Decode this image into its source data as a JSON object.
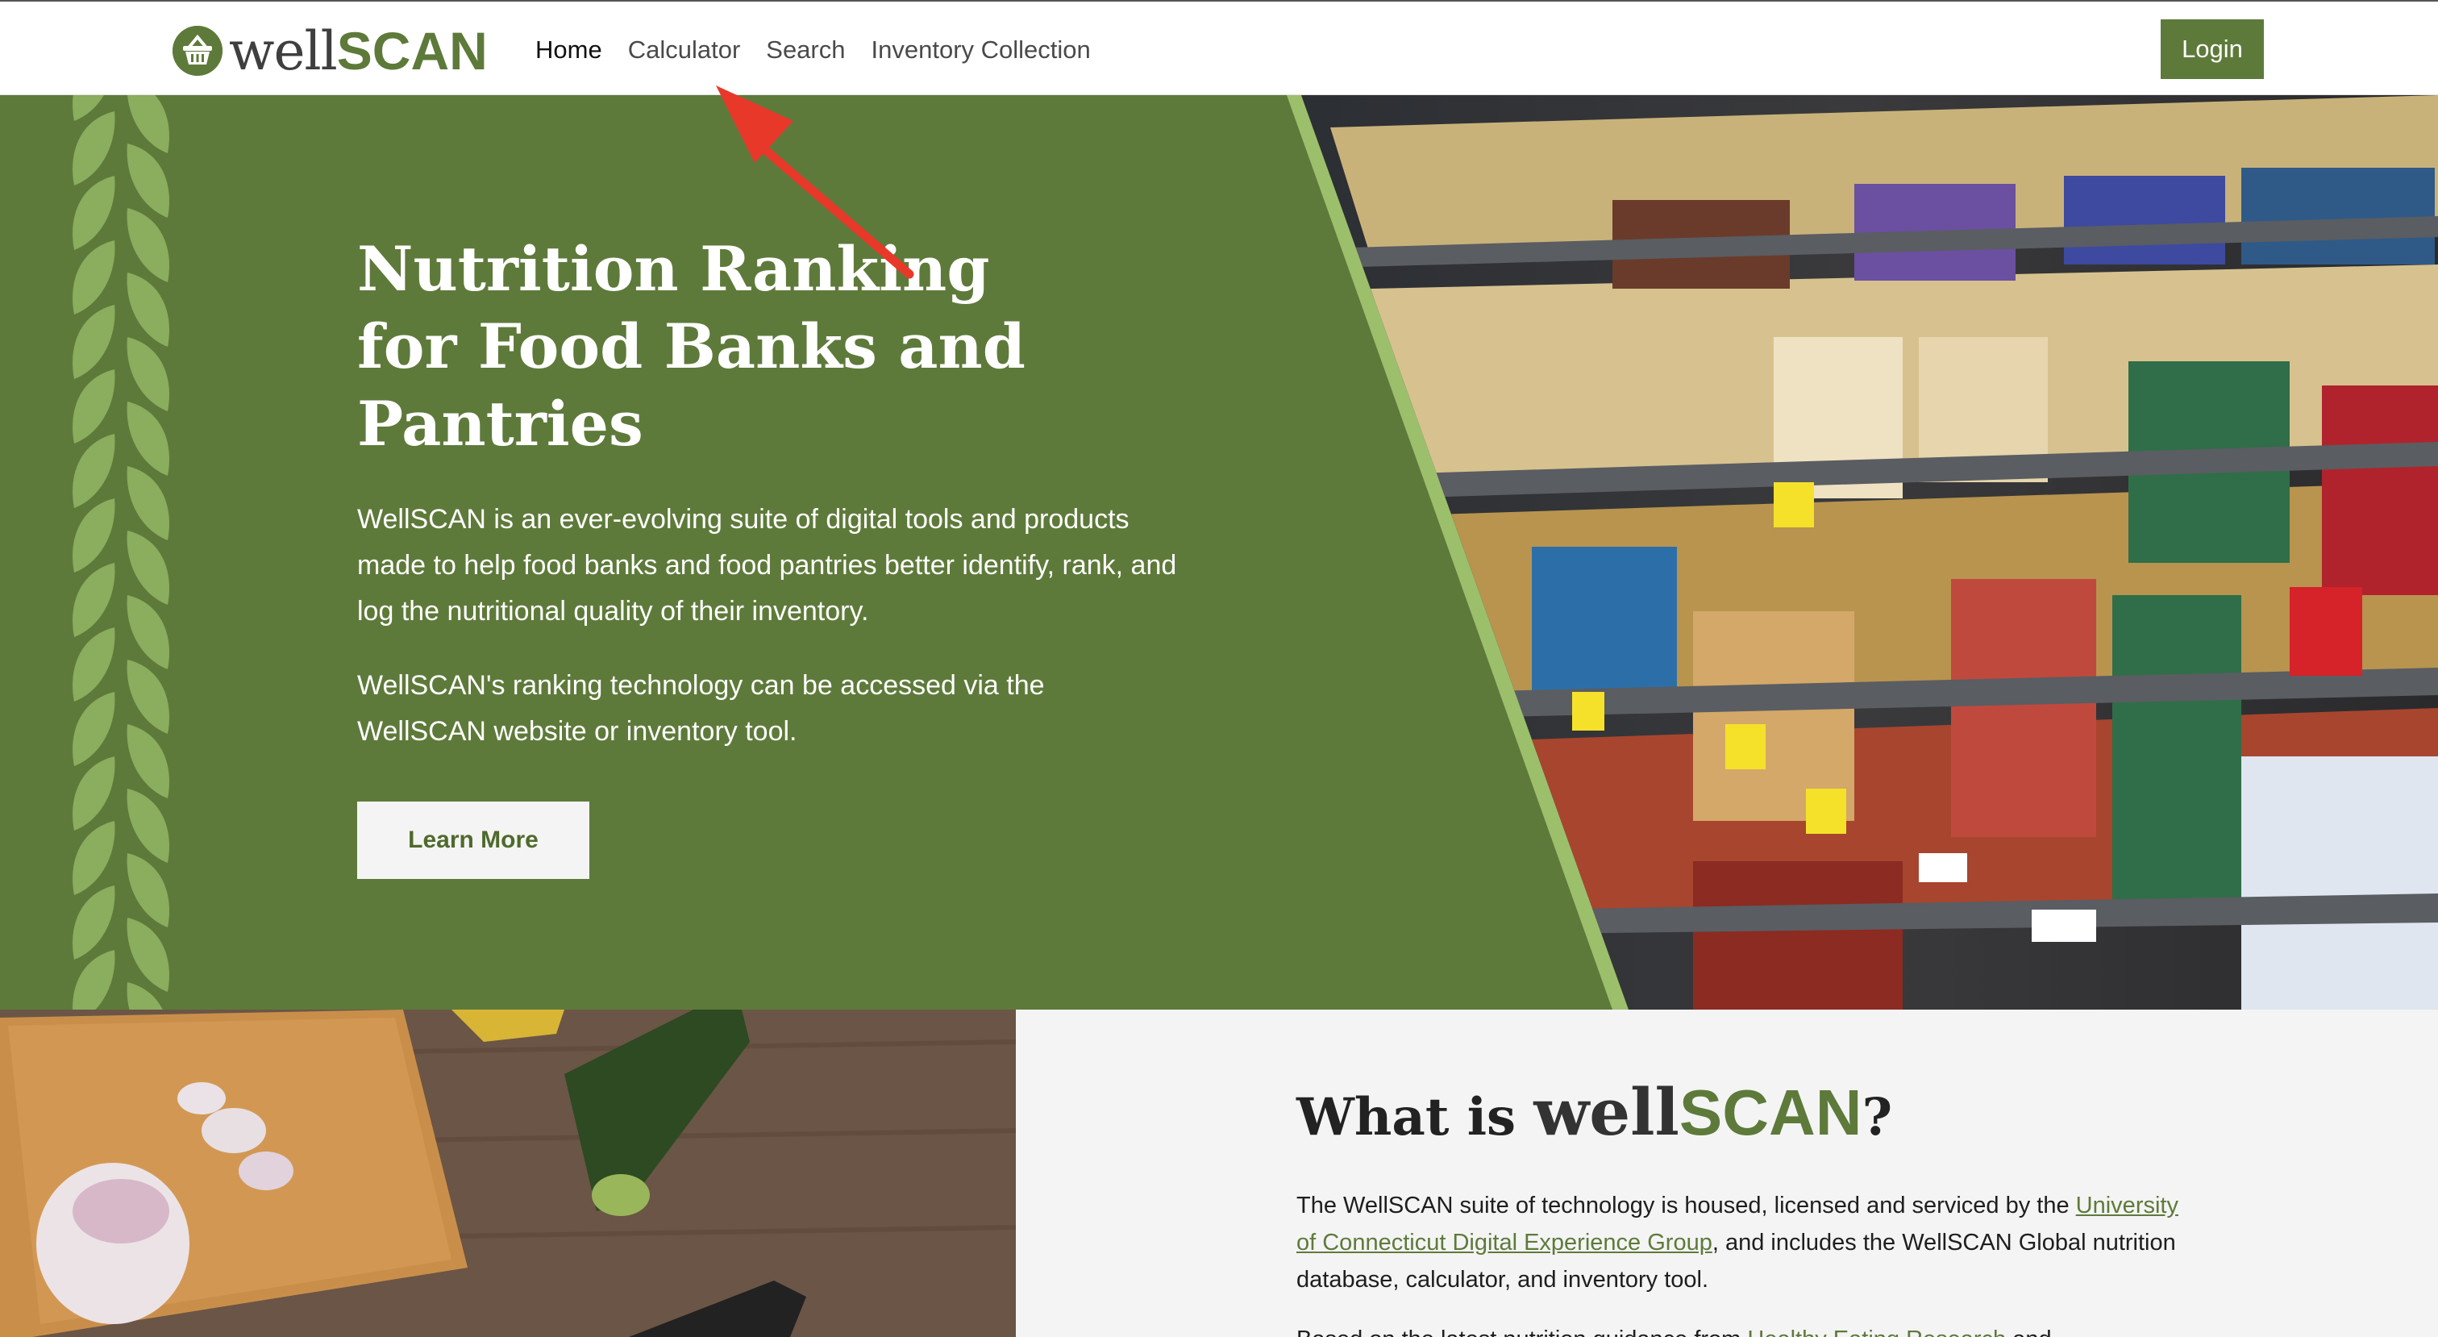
{
  "navbar": {
    "logo": {
      "part1": "well",
      "part2": "SCAN"
    },
    "links": [
      {
        "label": "Home",
        "active": true
      },
      {
        "label": "Calculator",
        "active": false
      },
      {
        "label": "Search",
        "active": false
      },
      {
        "label": "Inventory Collection",
        "active": false
      }
    ],
    "login_label": "Login"
  },
  "hero": {
    "title_bold": "Nutrition Ranking",
    "title_line2": "for Food Banks and",
    "title_line3": "Pantries",
    "paragraph1": "WellSCAN is an ever-evolving suite of digital tools and products made to help food banks and food pantries better identify, rank, and log the nutritional quality of their inventory.",
    "paragraph2": "WellSCAN's ranking technology can be accessed via the WellSCAN website or inventory tool.",
    "button_label": "Learn More",
    "photo_icon": "grocery-shelves-photo"
  },
  "about": {
    "title_prefix": "What is ",
    "title_well": "well",
    "title_scan": "SCAN",
    "title_suffix": "?",
    "p1_before": "The WellSCAN suite of technology is housed, licensed and serviced by the ",
    "p1_link": "University of Connecticut Digital Experience Group",
    "p1_after": ", and includes the WellSCAN Global nutrition database, calculator, and inventory tool.",
    "p2_before": "Based on the latest nutrition guidance from ",
    "p2_link": "Healthy Eating Research",
    "p2_after": " and",
    "photo_icon": "cutting-board-vegetables-photo"
  },
  "colors": {
    "brand_green": "#5e7a3a",
    "leaf_green": "#8aad5e",
    "annotation_red": "#e8382a",
    "section_gray": "#f4f4f4"
  }
}
